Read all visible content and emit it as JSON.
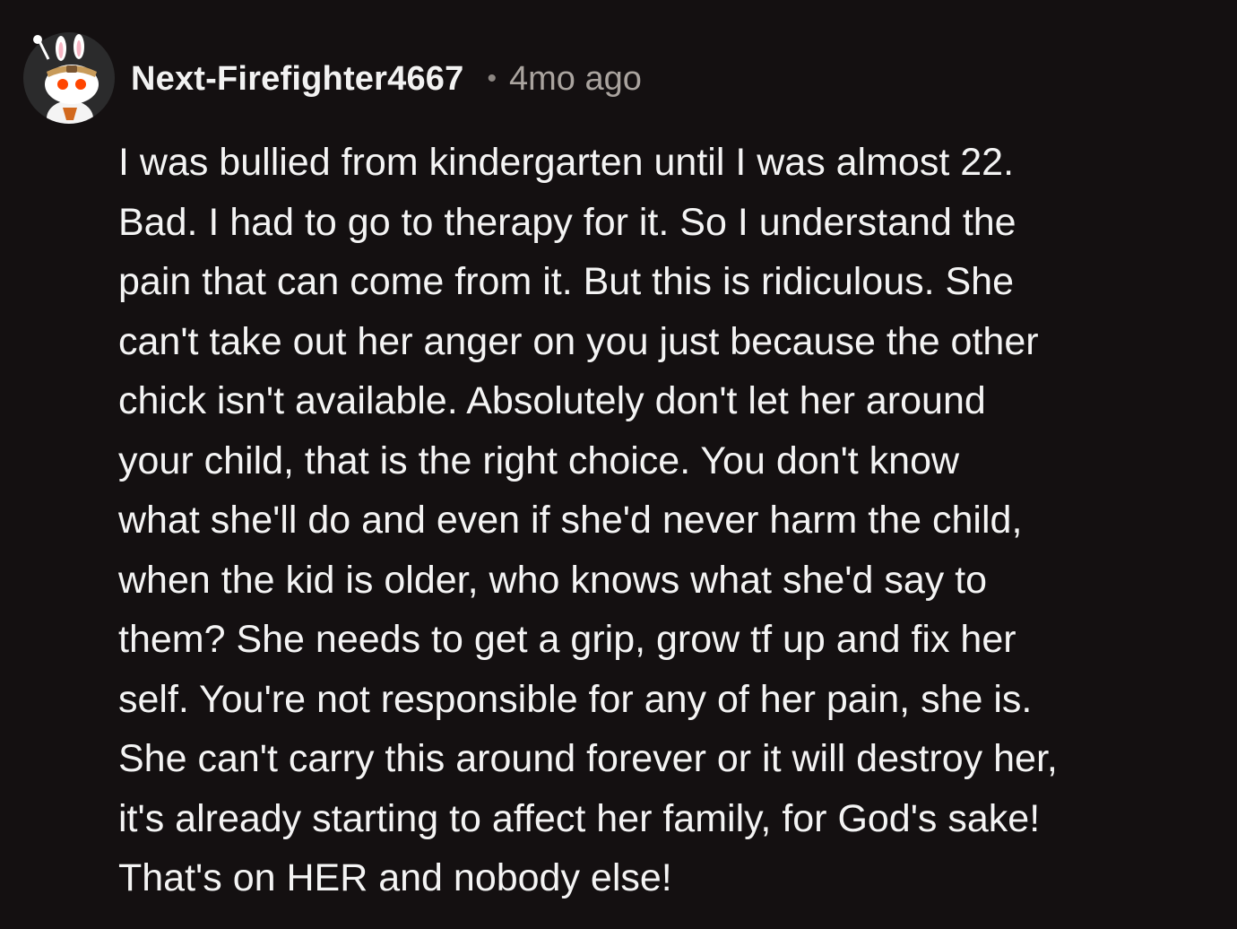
{
  "comment": {
    "username": "Next-Firefighter4667",
    "separator": "•",
    "timestamp": "4mo ago",
    "avatar_icon": "snoo-bunny-avatar-icon",
    "body_lines": [
      "I was bullied from kindergarten until I was almost 22.",
      "Bad. I had to go to therapy for it. So I understand the",
      "pain that can come from it. But this is ridiculous. She",
      "can't take out her anger on you just because the other",
      "chick isn't available. Absolutely don't let her around",
      "your child, that is the right choice. You don't know",
      "what she'll do and even if she'd never harm the child,",
      "when the kid is older, who knows what she'd say to",
      "them? She needs to get a grip, grow tf up and fix her",
      "self. You're not responsible for any of her pain, she is.",
      "She can't carry this around forever or it will destroy her,",
      "it's already starting to affect her family, for God's sake!",
      "That's on HER and nobody else!"
    ]
  },
  "colors": {
    "background": "#141011",
    "text": "#f4f4f4",
    "meta": "#aaa49f"
  }
}
